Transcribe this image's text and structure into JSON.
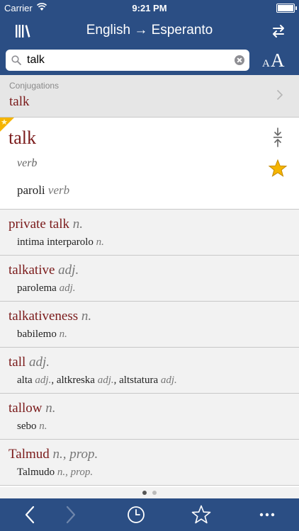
{
  "status_bar": {
    "carrier": "Carrier",
    "time": "9:21 PM"
  },
  "nav": {
    "title": "English → Esperanto"
  },
  "search": {
    "value": "talk"
  },
  "conjugations": {
    "label": "Conjugations",
    "word": "talk"
  },
  "main_entry": {
    "headword": "talk",
    "pos": "verb",
    "translation": "paroli",
    "translation_pos": "verb"
  },
  "entries": [
    {
      "word": "private talk",
      "pos": "n.",
      "translations": [
        {
          "text": "intima interparolo",
          "pos": "n.",
          "sep": ""
        }
      ]
    },
    {
      "word": "talkative",
      "pos": "adj.",
      "translations": [
        {
          "text": "parolema",
          "pos": "adj.",
          "sep": ""
        }
      ]
    },
    {
      "word": "talkativeness",
      "pos": "n.",
      "translations": [
        {
          "text": "babilemo",
          "pos": "n.",
          "sep": ""
        }
      ]
    },
    {
      "word": "tall",
      "pos": "adj.",
      "translations": [
        {
          "text": "alta",
          "pos": "adj.",
          "sep": ", "
        },
        {
          "text": "altkreska",
          "pos": "adj.",
          "sep": ", "
        },
        {
          "text": "altstatura",
          "pos": "adj.",
          "sep": ""
        }
      ]
    },
    {
      "word": "tallow",
      "pos": "n.",
      "translations": [
        {
          "text": "sebo",
          "pos": "n.",
          "sep": ""
        }
      ]
    },
    {
      "word": "Talmud",
      "pos": "n., prop.",
      "translations": [
        {
          "text": "Talmudo",
          "pos": "n., prop.",
          "sep": ""
        }
      ]
    }
  ],
  "icons": {
    "wifi": "wifi-icon",
    "battery": "battery-icon",
    "library": "library-icon",
    "swap": "swap-icon",
    "search": "search-icon",
    "clear": "clear-icon",
    "font_size": "font-size-icon",
    "chevron": "chevron-right-icon",
    "collapse": "collapse-icon",
    "favorite": "star-icon",
    "back": "back-icon",
    "forward": "forward-icon",
    "history": "clock-icon",
    "favorites": "star-outline-icon",
    "more": "more-icon"
  },
  "colors": {
    "nav_bg": "#2b4e84",
    "headword": "#7a1a1a",
    "star_gold": "#f5b400",
    "row_bg": "#f2f2f2"
  }
}
